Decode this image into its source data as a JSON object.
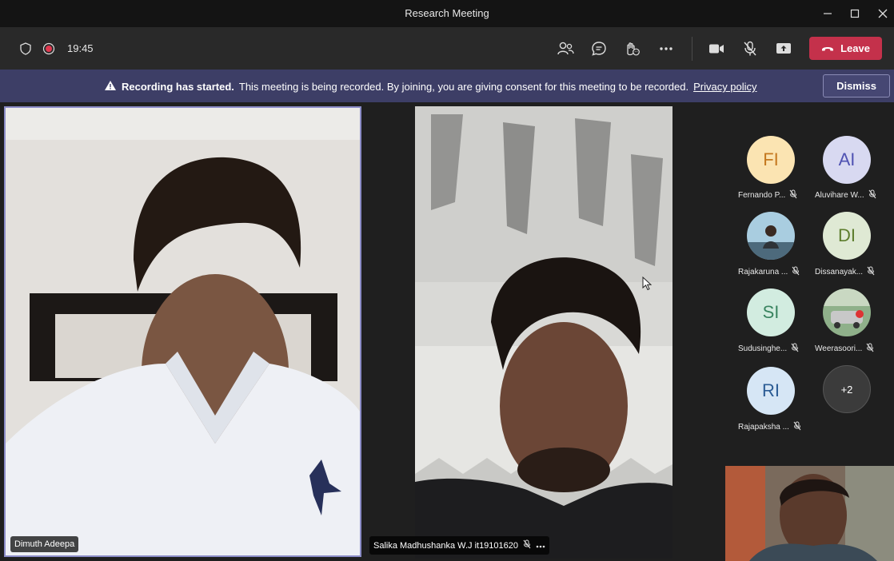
{
  "window": {
    "title": "Research Meeting"
  },
  "toolbar": {
    "timer": "19:45",
    "leave_label": "Leave"
  },
  "banner": {
    "bold_text": "Recording has started.",
    "text": "This meeting is being recorded. By joining, you are giving consent for this meeting to be recorded.",
    "link": "Privacy policy",
    "dismiss_label": "Dismiss"
  },
  "videos": [
    {
      "name": "Dimuth Adeepa"
    },
    {
      "name": "Salika Madhushanka W.J it19101620"
    }
  ],
  "participants": [
    {
      "initials": "FI",
      "name": "Fernando P...",
      "bg": "#fbe4b2",
      "fg": "#c4781f"
    },
    {
      "initials": "AI",
      "name": "Aluvihare W...",
      "bg": "#d8d9f1",
      "fg": "#4f52b2"
    },
    {
      "initials": "",
      "name": "Rajakaruna ...",
      "bg": "#9fc3d6",
      "fg": "#ffffff"
    },
    {
      "initials": "DI",
      "name": "Dissanayak...",
      "bg": "#dfe9d4",
      "fg": "#5d7d2d"
    },
    {
      "initials": "SI",
      "name": "Sudusinghe...",
      "bg": "#d2ece0",
      "fg": "#3a8460"
    },
    {
      "initials": "",
      "name": "Weerasoori...",
      "bg": "#6c8f6a",
      "fg": "#ffffff"
    },
    {
      "initials": "RI",
      "name": "Rajapaksha ...",
      "bg": "#d6e6f5",
      "fg": "#2b5c94"
    }
  ],
  "overflow_count": "+2",
  "colors": {
    "leave": "#c4314b",
    "banner": "#3d3e66",
    "active_border": "#8b8cc7"
  }
}
